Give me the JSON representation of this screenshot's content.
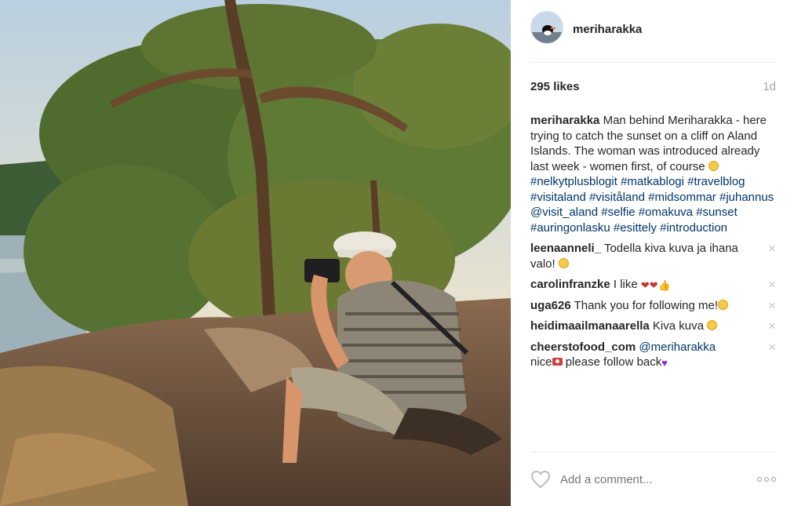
{
  "post": {
    "username": "meriharakka",
    "likes": "295 likes",
    "time": "1d",
    "caption": {
      "user": "meriharakka",
      "text": "Man behind Meriharakka - here trying to catch the sunset on a cliff on Aland Islands. The woman was introduced already last week - women first, of course",
      "hashtags": [
        "#nelkytplusblogit",
        "#matkablogi",
        "#travelblog",
        "#visitaland",
        "#visitåland",
        "#midsommar",
        "#juhannus",
        "@visit_aland",
        "#selfie",
        "#omakuva",
        "#sunset",
        "#auringonlasku",
        "#esittely",
        "#introduction"
      ]
    }
  },
  "comments": [
    {
      "user": "leenaanneli_",
      "text": "Todella kiva kuva ja ihana valo!"
    },
    {
      "user": "carolinfranzke",
      "text": "I like"
    },
    {
      "user": "uga626",
      "text": "Thank you for following me!"
    },
    {
      "user": "heidimaailmanaarella",
      "text": "Kiva kuva"
    },
    {
      "user": "cheerstofood_com",
      "mention": "@meriharakka",
      "text1": "nice",
      "text2": "please follow back"
    }
  ],
  "footer": {
    "comment_placeholder": "Add a comment..."
  },
  "icons": {
    "delete": "close-icon",
    "like": "heart-outline-icon",
    "more": "more-options-icon"
  },
  "colors": {
    "link": "#003569",
    "muted": "#a5a7aa"
  }
}
